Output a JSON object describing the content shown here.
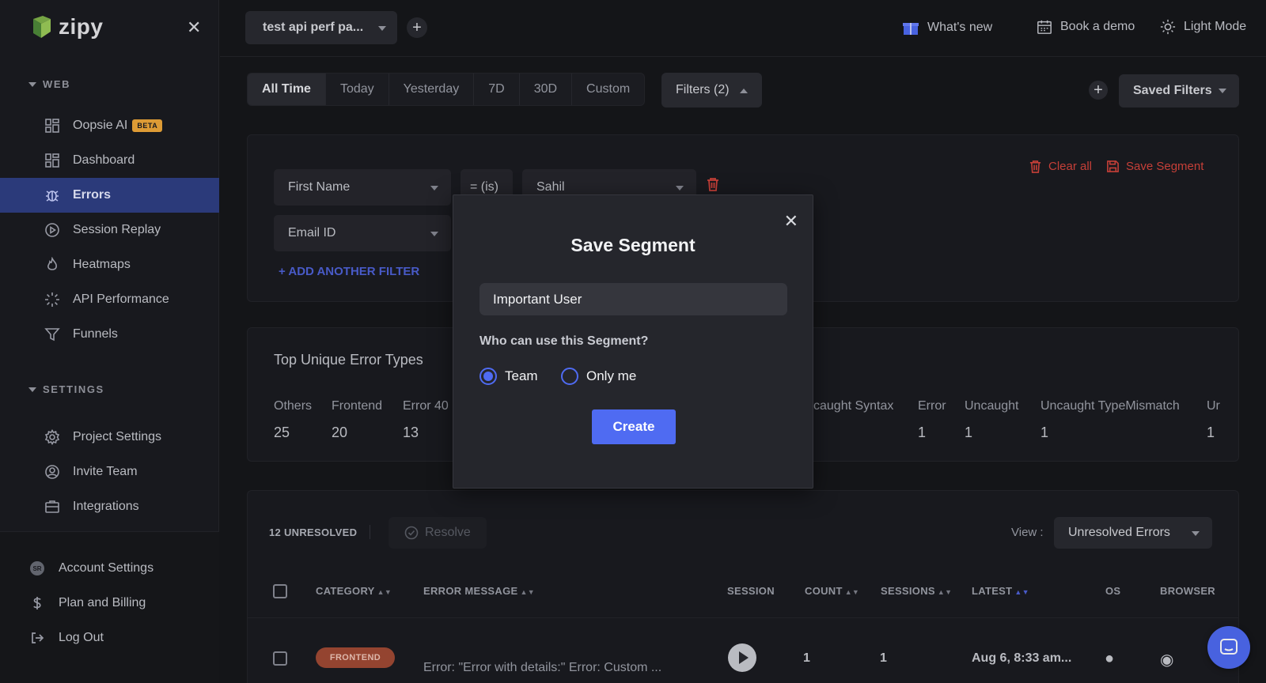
{
  "brand": {
    "name": "zipy",
    "accent": "#4f6bf2"
  },
  "sidebar": {
    "web_section": "WEB",
    "settings_section": "SETTINGS",
    "web_items": [
      {
        "label": "Oopsie AI",
        "badge": "BETA",
        "icon": "grid-icon"
      },
      {
        "label": "Dashboard",
        "icon": "grid-icon"
      },
      {
        "label": "Errors",
        "icon": "bug-icon",
        "active": true
      },
      {
        "label": "Session Replay",
        "icon": "play-circle-icon"
      },
      {
        "label": "Heatmaps",
        "icon": "flame-icon"
      },
      {
        "label": "API Performance",
        "icon": "spinner-icon"
      },
      {
        "label": "Funnels",
        "icon": "funnel-icon"
      }
    ],
    "settings_items": [
      {
        "label": "Project Settings",
        "icon": "gear-icon"
      },
      {
        "label": "Invite Team",
        "icon": "user-circle-icon"
      },
      {
        "label": "Integrations",
        "icon": "briefcase-icon"
      }
    ],
    "bottom_items": [
      {
        "label": "Account Settings",
        "avatar": "SR"
      },
      {
        "label": "Plan and Billing",
        "icon": "dollar-icon"
      },
      {
        "label": "Log Out",
        "icon": "logout-icon"
      }
    ]
  },
  "topbar": {
    "project": "test api perf pa...",
    "whats_new": "What's new",
    "book_demo": "Book a demo",
    "light_mode": "Light Mode"
  },
  "date_tabs": [
    "All Time",
    "Today",
    "Yesterday",
    "7D",
    "30D",
    "Custom"
  ],
  "filters_label": "Filters (2)",
  "saved_filters": "Saved Filters",
  "filter_panel": {
    "field1": "First Name",
    "operator1": "= (is)",
    "value1": "Sahil",
    "field2": "Email ID",
    "add_filter": "+ ADD ANOTHER FILTER",
    "clear_all": "Clear all",
    "save_segment": "Save Segment"
  },
  "error_types": {
    "title": "Top Unique Error Types",
    "items": [
      {
        "label": "Others",
        "count": "25"
      },
      {
        "label": "Frontend",
        "count": "20"
      },
      {
        "label": "Error 40",
        "count": "13"
      },
      {
        "label": "caught Syntax",
        "count": ""
      },
      {
        "label": "Error",
        "count": "1"
      },
      {
        "label": "Uncaught",
        "count": "1"
      },
      {
        "label": "Uncaught TypeMismatch",
        "count": "1"
      },
      {
        "label": "Ur",
        "count": "1"
      }
    ]
  },
  "table": {
    "unresolved": "12 UNRESOLVED",
    "resolve": "Resolve",
    "view_label": "View :",
    "view_value": "Unresolved Errors",
    "columns": [
      "CATEGORY",
      "ERROR MESSAGE",
      "SESSION",
      "COUNT",
      "SESSIONS",
      "LATEST",
      "OS",
      "BROWSER"
    ],
    "row": {
      "category": "FRONTEND",
      "message": "Error: \"Error with details:\" Error: Custom ...",
      "count": "1",
      "sessions": "1",
      "latest": "Aug 6, 8:33 am..."
    }
  },
  "modal": {
    "title": "Save Segment",
    "input_value": "Important User",
    "question": "Who can use this Segment?",
    "option_team": "Team",
    "option_only_me": "Only me",
    "selected": "Team",
    "create": "Create"
  }
}
